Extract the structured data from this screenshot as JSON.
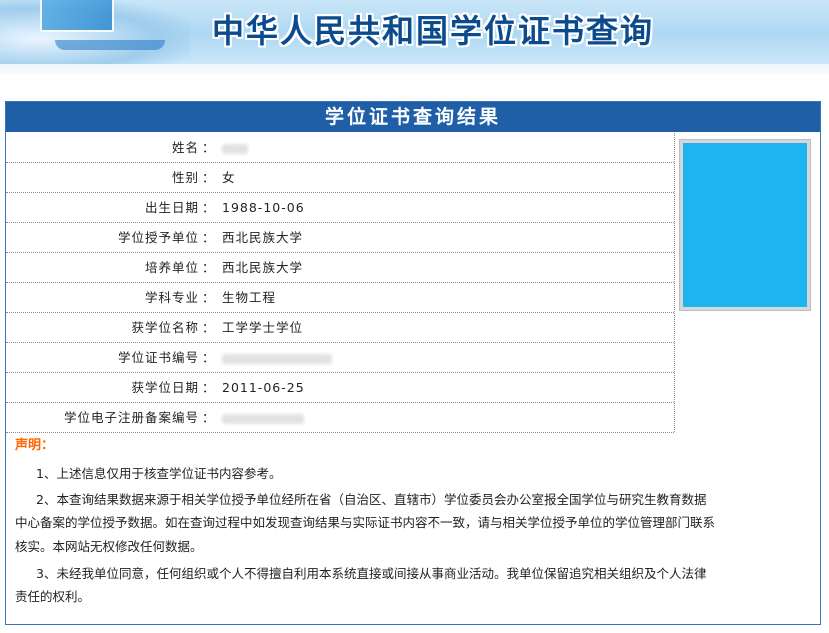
{
  "header": {
    "title": "中华人民共和国学位证书查询"
  },
  "panel": {
    "title": "学位证书查询结果",
    "fields": [
      {
        "label": "姓名",
        "value": ""
      },
      {
        "label": "性别",
        "value": "女"
      },
      {
        "label": "出生日期",
        "value": "1988-10-06"
      },
      {
        "label": "学位授予单位",
        "value": "西北民族大学"
      },
      {
        "label": "培养单位",
        "value": "西北民族大学"
      },
      {
        "label": "学科专业",
        "value": "生物工程"
      },
      {
        "label": "获学位名称",
        "value": "工学学士学位"
      },
      {
        "label": "学位证书编号",
        "value": ""
      },
      {
        "label": "获学位日期",
        "value": "2011-06-25"
      },
      {
        "label": "学位电子注册备案编号",
        "value": ""
      }
    ],
    "colon": "：",
    "photo_color": "#1cb5f2"
  },
  "declaration": {
    "title": "声明：",
    "lines": [
      "1、上述信息仅用于核查学位证书内容参考。",
      "2、本查询结果数据来源于相关学位授予单位经所在省（自治区、直辖市）学位委员会办公室报全国学位与研究生教育数据",
      "中心备案的学位授予数据。如在查询过程中如发现查询结果与实际证书内容不一致，请与相关学位授予单位的学位管理部门联系",
      "核实。本网站无权修改任何数据。",
      "3、未经我单位同意，任何组织或个人不得擅自利用本系统直接或间接从事商业活动。我单位保留追究相关组织及个人法律",
      "责任的权利。"
    ]
  },
  "colors": {
    "header_title": "#0b4a8c",
    "panel_head": "#1f5fa8",
    "declaration_title": "#ff6600"
  }
}
